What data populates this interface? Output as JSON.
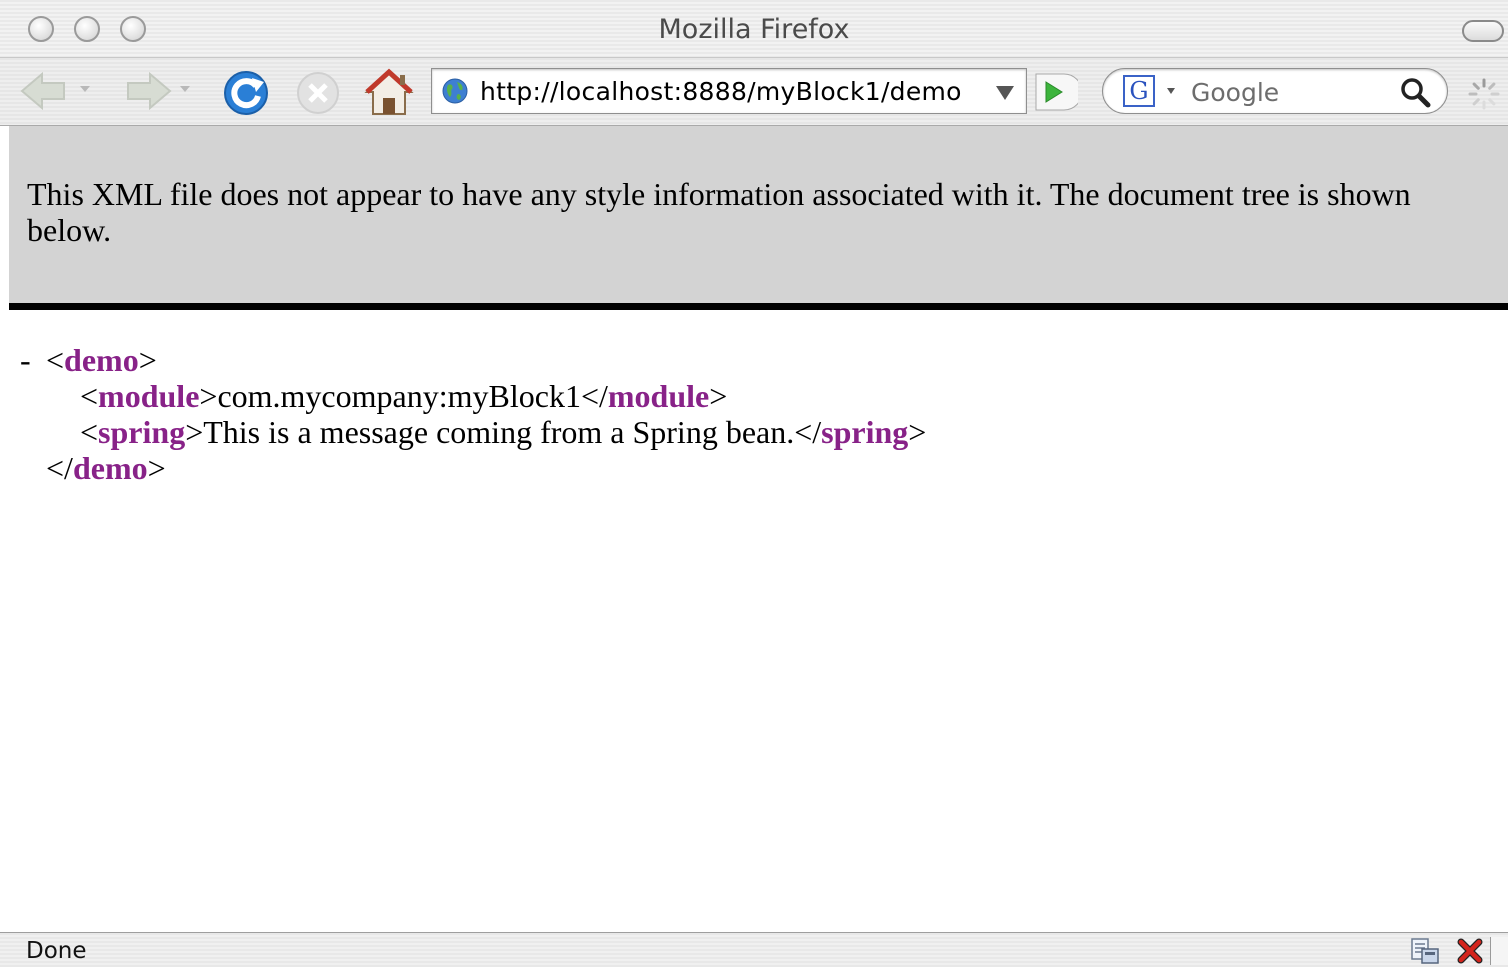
{
  "window": {
    "title": "Mozilla Firefox"
  },
  "toolbar": {
    "url": "http://localhost:8888/myBlock1/demo",
    "search_placeholder": "Google",
    "search_engine_letter": "G"
  },
  "icons": {
    "back": "back-arrow-icon",
    "forward": "forward-arrow-icon",
    "reload": "reload-icon",
    "stop": "stop-icon",
    "home": "home-icon",
    "site": "globe-icon",
    "go": "go-arrow-icon",
    "search": "magnifier-icon",
    "throbber": "loading-spinner-icon",
    "status_1": "page-info-icon",
    "status_2": "error-x-icon"
  },
  "colors": {
    "xml_tag": "#882288",
    "info_background": "#d3d3d3",
    "go_arrow": "#3cb43c",
    "reload_blue": "#2a7fd6"
  },
  "content": {
    "info_message": "This XML file does not appear to have any style information associated with it. The document tree is shown below.",
    "collapse_marker": "-",
    "xml": {
      "root_tag": "demo",
      "module_tag": "module",
      "module_value": "com.mycompany:myBlock1",
      "spring_tag": "spring",
      "spring_value": "This is a message coming from a Spring bean."
    }
  },
  "status": {
    "text": "Done"
  }
}
